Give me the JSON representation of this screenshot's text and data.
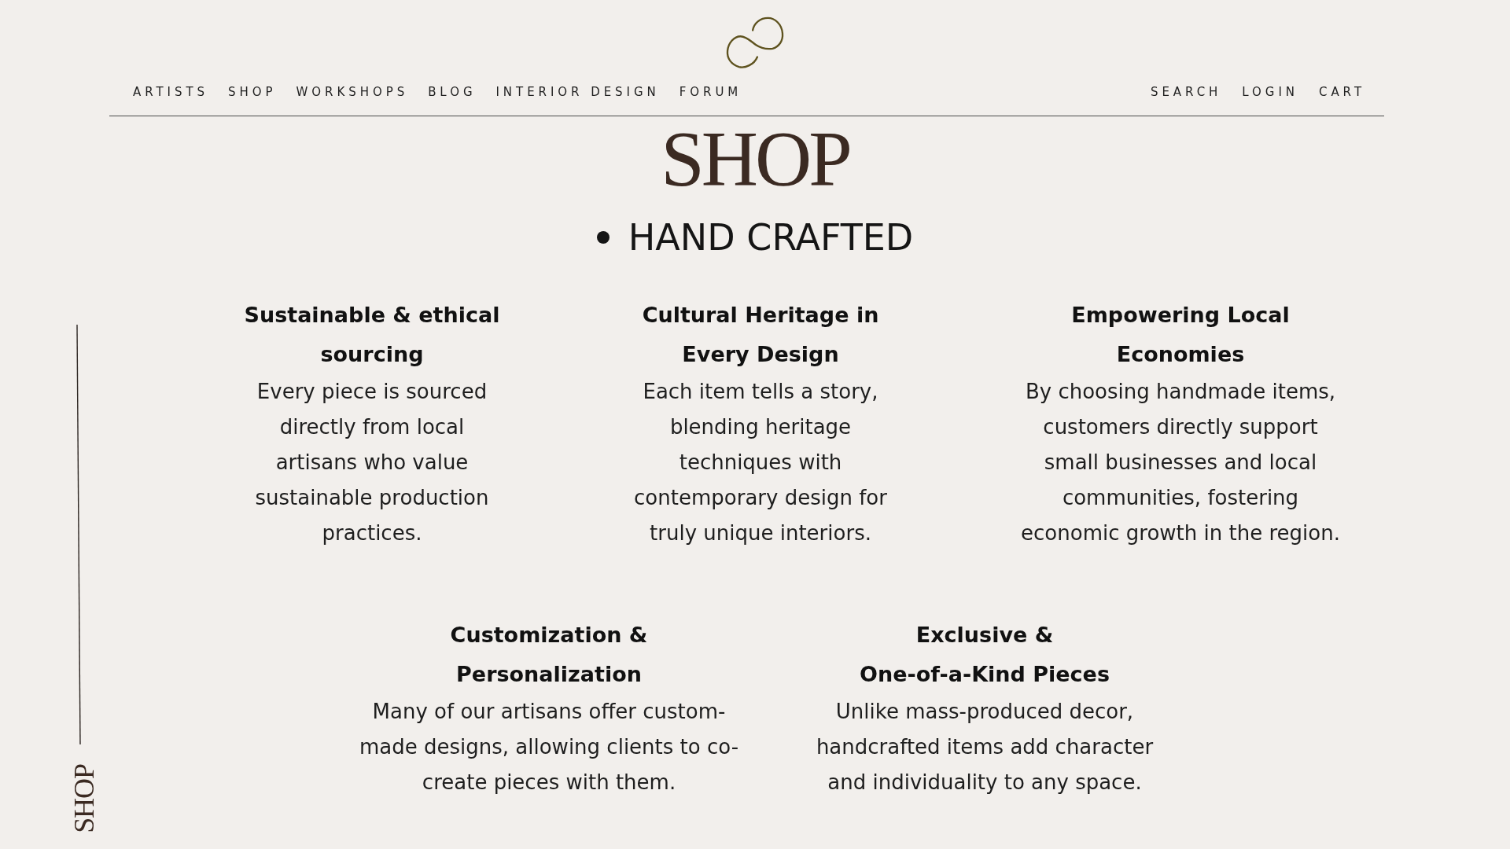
{
  "nav": {
    "left": [
      "ARTISTS",
      "SHOP",
      "WORKSHOPS",
      "BLOG",
      "INTERIOR DESIGN",
      "FORUM"
    ],
    "right": [
      "SEARCH",
      "LOGIN",
      "CART"
    ]
  },
  "page_title": "SHOP",
  "tagline": "HAND CRAFTED",
  "feature_rows": [
    [
      {
        "title": [
          "Sustainable & ethical",
          "sourcing"
        ],
        "text": [
          "Every piece is sourced",
          "directly from local",
          "artisans who value",
          "sustainable production",
          "practices."
        ]
      },
      {
        "title": [
          "Cultural Heritage in",
          "Every Design"
        ],
        "text": [
          "Each item tells a story,",
          "blending heritage",
          "techniques with",
          "contemporary design for",
          "truly unique interiors."
        ]
      },
      {
        "title": [
          "Empowering Local",
          "Economies"
        ],
        "text": [
          "By choosing handmade items,",
          "customers directly support",
          "small businesses and local",
          "communities, fostering",
          "economic growth in the region."
        ]
      }
    ],
    [
      {
        "title": [
          "Customization &",
          "Personalization"
        ],
        "text": [
          "Many of our artisans offer custom-",
          "made designs, allowing clients to co-",
          "create pieces with them."
        ]
      },
      {
        "title": [
          "Exclusive &",
          "One-of-a-Kind Pieces"
        ],
        "text": [
          "Unlike mass-produced decor,",
          "handcrafted items add character",
          "and individuality to any space."
        ]
      }
    ]
  ],
  "side_label": "SHOP"
}
